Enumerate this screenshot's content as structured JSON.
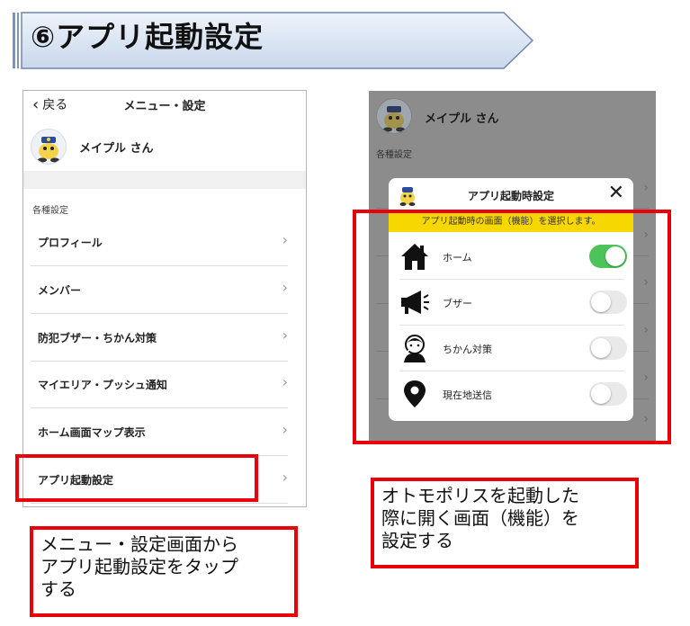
{
  "banner": {
    "title": "⑥アプリ起動設定"
  },
  "left_screen": {
    "nav": {
      "back_label": "戻る",
      "title": "メニュー・設定"
    },
    "user_name": "メイプル さん",
    "section_label": "各種設定",
    "menu_items": [
      {
        "label": "プロフィール"
      },
      {
        "label": "メンバー"
      },
      {
        "label": "防犯ブザー・ちかん対策"
      },
      {
        "label": "マイエリア・プッシュ通知"
      },
      {
        "label": "ホーム画面マップ表示"
      },
      {
        "label": "アプリ起動設定"
      }
    ]
  },
  "right_screen": {
    "user_name": "メイプル さん",
    "section_label": "各種設定",
    "modal": {
      "title": "アプリ起動時設定",
      "note": "アプリ起動時の画面（機能）を選択します。",
      "options": [
        {
          "label": "ホーム",
          "icon": "home-icon",
          "enabled": true
        },
        {
          "label": "ブザー",
          "icon": "megaphone-icon",
          "enabled": false
        },
        {
          "label": "ちかん対策",
          "icon": "molester-alert-icon",
          "enabled": false
        },
        {
          "label": "現在地送信",
          "icon": "location-pin-icon",
          "enabled": false
        }
      ]
    }
  },
  "captions": {
    "left": "メニュー・設定画面から\nアプリ起動設定をタップ\nする",
    "right": "オトモポリスを起動した\n際に開く画面（機能）を\n設定する"
  },
  "colors": {
    "highlight_red": "#e8000b",
    "toggle_on": "#4cc45a",
    "note_yellow": "#f7d700",
    "banner_fill": "#dbe6f4"
  }
}
